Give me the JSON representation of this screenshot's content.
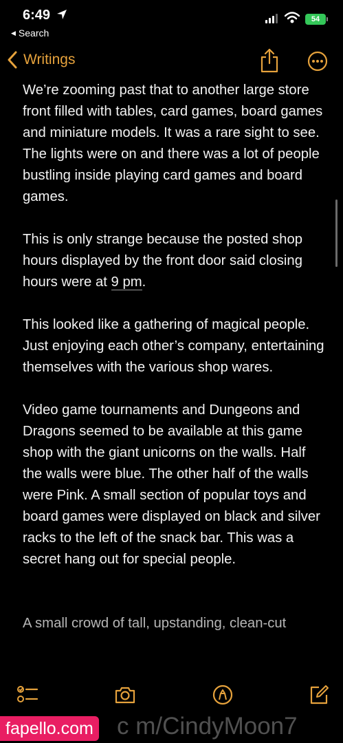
{
  "status_bar": {
    "time": "6:49",
    "back_app": "Search",
    "battery": "54"
  },
  "nav": {
    "back_label": "Writings"
  },
  "note": {
    "paragraphs": [
      "We’re zooming past that to another large store front filled with tables, card games, board games and miniature models. It was a rare sight to see. The lights were on and there was a lot of people bustling inside playing card games and board games.",
      "This is only strange because the posted shop hours displayed by the front door said closing hours were at",
      "9 pm",
      ".",
      "This looked like a gathering of magical people. Just enjoying each other’s company, entertaining themselves with the various shop wares.",
      "Video game tournaments and Dungeons and Dragons seemed to be available at this game shop with the giant unicorns on the walls. Half the walls were blue. The other half of the walls were Pink. A small section of popular toys and board games were displayed on black and silver racks to the left of the snack bar. This was a secret hang out for special people.",
      "A small crowd of tall, upstanding, clean-cut"
    ]
  },
  "watermark": {
    "site": "fapello.com",
    "text": "c m/CindyMoon7"
  },
  "colors": {
    "accent": "#e6a23c",
    "background": "#000000",
    "text": "#f2f2f2",
    "battery": "#34c759",
    "watermark": "#e91e63"
  },
  "icons": {
    "toolbar": [
      "checklist-icon",
      "camera-icon",
      "markup-pen-icon",
      "compose-icon"
    ]
  }
}
